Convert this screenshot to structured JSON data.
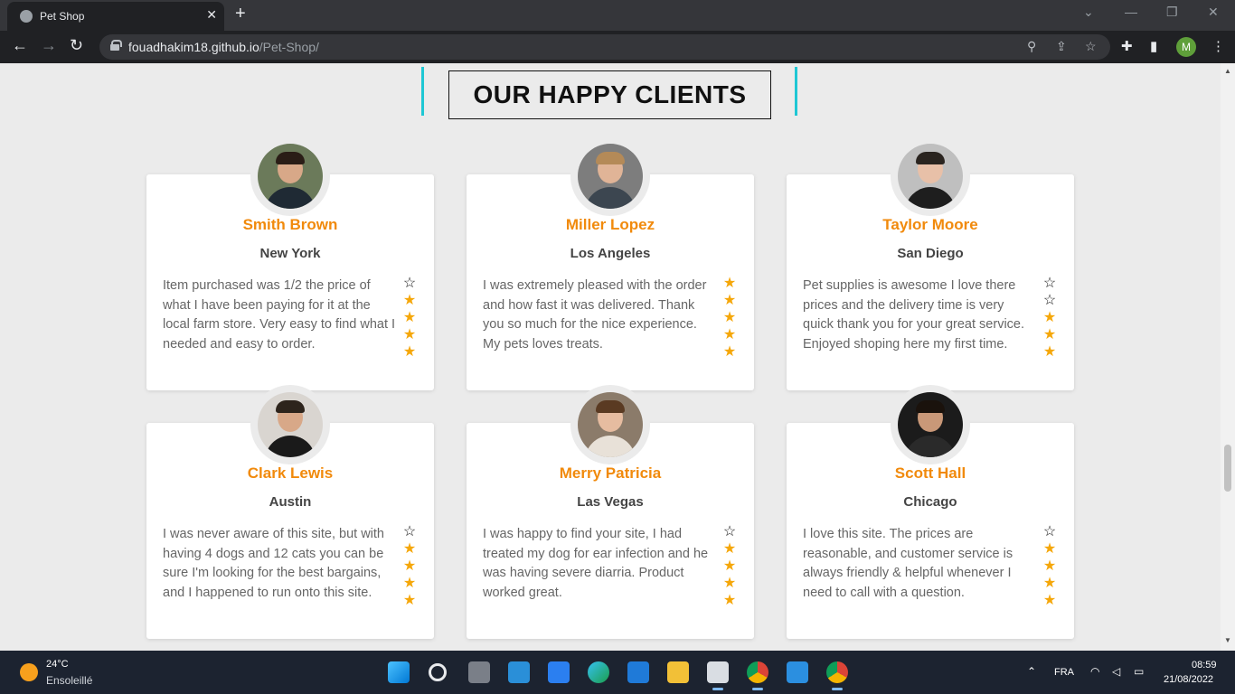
{
  "browser": {
    "tab_title": "Pet Shop",
    "tab_close": "✕",
    "new_tab": "+",
    "url_host": "fouadhakim18.github.io",
    "url_path": "/Pet-Shop/",
    "profile_initial": "M"
  },
  "section": {
    "title": "OUR HAPPY CLIENTS",
    "accent_color": "#1ec7d4"
  },
  "colors": {
    "name": "#f18a0c",
    "star_filled": "#f5a70a",
    "star_empty": "#111111"
  },
  "clients": [
    {
      "name": "Smith Brown",
      "city": "New York",
      "review": "Item purchased was 1/2 the price of what I have been paying for it at the local farm store. Very easy to find what I needed and easy to order.",
      "rating": 4
    },
    {
      "name": "Miller Lopez",
      "city": "Los Angeles",
      "review": "I was extremely pleased with the order and how fast it was delivered. Thank you so much for the nice experience. My pets loves treats.",
      "rating": 5
    },
    {
      "name": "Taylor Moore",
      "city": "San Diego",
      "review": "Pet supplies is awesome I love there prices and the delivery time is very quick thank you for your great service. Enjoyed shoping here my first time.",
      "rating": 3
    },
    {
      "name": "Clark Lewis",
      "city": "Austin",
      "review": "I was never aware of this site, but with having 4 dogs and 12 cats you can be sure I'm looking for the best bargains, and I happened to run onto this site.",
      "rating": 4
    },
    {
      "name": "Merry Patricia",
      "city": "Las Vegas",
      "review": "I was happy to find your site, I had treated my dog for ear infection and he was having severe diarria. Product worked great.",
      "rating": 4
    },
    {
      "name": "Scott Hall",
      "city": "Chicago",
      "review": "I love this site. The prices are reasonable, and customer service is always friendly & helpful whenever I need to call with a question.",
      "rating": 4
    }
  ],
  "taskbar": {
    "weather_temp": "24°C",
    "weather_desc": "Ensoleillé",
    "language": "FRA",
    "time": "08:59",
    "date": "21/08/2022"
  }
}
